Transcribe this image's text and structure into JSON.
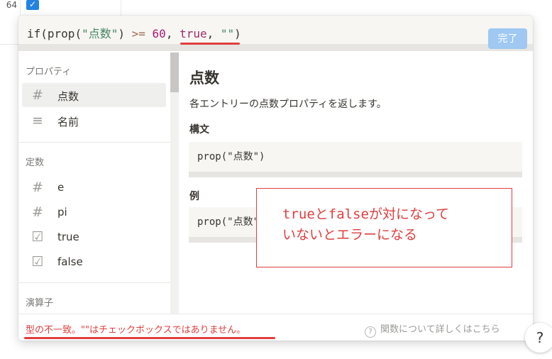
{
  "background": {
    "row_number": "64",
    "row_checked": true
  },
  "editor": {
    "formula_parts": {
      "if_open": "if(",
      "prop_open": "prop(",
      "prop_name": "\"点数\"",
      "prop_close": ")",
      "op": ">=",
      "num": "60",
      "comma1": ",",
      "kw_true": "true",
      "comma2": ",",
      "empty_str": "\"\"",
      "close": ")"
    },
    "done_label": "完了"
  },
  "sidebar": {
    "sections": [
      {
        "title": "プロパティ",
        "items": [
          {
            "icon": "#",
            "label": "点数",
            "selected": true
          },
          {
            "icon": "≡",
            "label": "名前",
            "selected": false
          }
        ]
      },
      {
        "title": "定数",
        "items": [
          {
            "icon": "#",
            "label": "e",
            "selected": false
          },
          {
            "icon": "#",
            "label": "pi",
            "selected": false
          },
          {
            "icon": "☑",
            "label": "true",
            "selected": false
          },
          {
            "icon": "☑",
            "label": "false",
            "selected": false
          }
        ]
      },
      {
        "title": "演算子",
        "items": []
      }
    ]
  },
  "detail": {
    "title": "点数",
    "description": "各エントリーの点数プロパティを返します。",
    "syntax_heading": "構文",
    "syntax_code": "prop(\"点数\")",
    "example_heading": "例",
    "example_code": "prop(\"点数\")"
  },
  "footer": {
    "error": "型の不一致。\"\"はチェックボックスではありません。",
    "help_icon": "?",
    "help_text": "関数について詳しくはこちら"
  },
  "annotation": {
    "line1": "trueとfalseが対になって",
    "line2": "いないとエラーになる"
  },
  "float_help_label": "?",
  "colors": {
    "error_red": "#e03e3e",
    "accent_blue": "#9fc8f2",
    "string_green": "#448361",
    "number_magenta": "#ad1a72"
  }
}
